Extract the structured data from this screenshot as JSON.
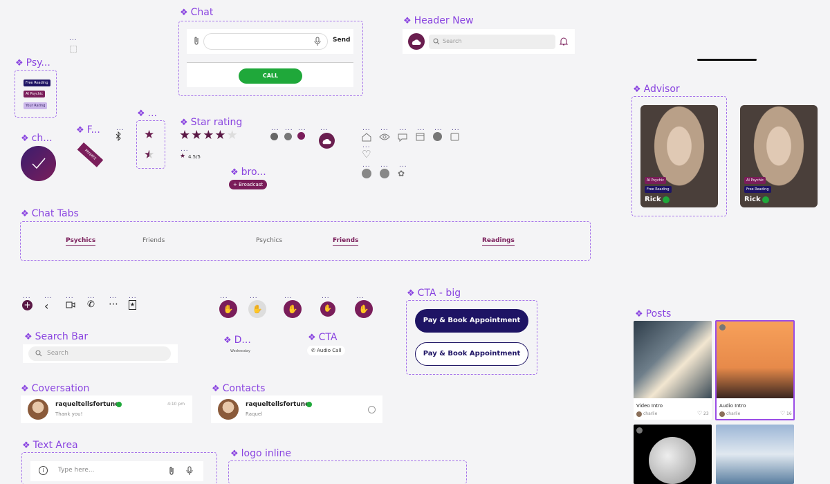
{
  "labels": {
    "chat": "Chat",
    "header_new": "Header New",
    "psy": "Psy...",
    "ch": "ch...",
    "f": "F...",
    "ellipsis": "...",
    "star_rating": "Star rating",
    "bro": "bro...",
    "advisor": "Advisor",
    "chat_tabs": "Chat Tabs",
    "cta_big": "CTA - big",
    "search_bar": "Search Bar",
    "d": "D...",
    "cta": "CTA",
    "posts": "Posts",
    "coversation": "Coversation",
    "contacts": "Contacts",
    "text_area": "Text Area",
    "logo_inline": "logo inline"
  },
  "chat": {
    "send": "Send",
    "call": "CALL"
  },
  "header": {
    "search_placeholder": "Search"
  },
  "psychic_tags": [
    "Free Reading",
    "AI Psychic",
    "Your Rating"
  ],
  "private_ribbon": "PRIVATE",
  "rating": {
    "text": "4.5/5",
    "value": 4.5,
    "max": 5
  },
  "broadcast": "+ Broadcast",
  "advisors": [
    {
      "tag1": "AI Psychic",
      "tag2": "Free Reading",
      "name": "Rick"
    },
    {
      "tag1": "AI Psychic",
      "tag2": "Free Reading",
      "name": "Rick"
    }
  ],
  "tabs": [
    "Psychics",
    "Friends",
    "Psychics",
    "Friends",
    "Readings"
  ],
  "cta_big": {
    "primary": "Pay & Book Appointment",
    "secondary": "Pay & Book Appointment"
  },
  "search_bar": {
    "placeholder": "Search"
  },
  "date_label": "Wednesday",
  "cta_small": "Audio Call",
  "posts": [
    {
      "title": "Video Intro",
      "user": "charlie",
      "likes": "23"
    },
    {
      "title": "Audio Intro",
      "user": "charlie",
      "likes": "16"
    }
  ],
  "conversation": {
    "name": "raqueltellsfortune",
    "message": "Thank you!",
    "time": "4:10 pm"
  },
  "contact": {
    "name": "raqueltellsfortune",
    "subtitle": "Raquel"
  },
  "text_area": {
    "placeholder": "Type here..."
  },
  "colors": {
    "accent": "#8a45e0",
    "brand": "#7a1d5a",
    "navy": "#1e1464",
    "green": "#1fa83a"
  }
}
